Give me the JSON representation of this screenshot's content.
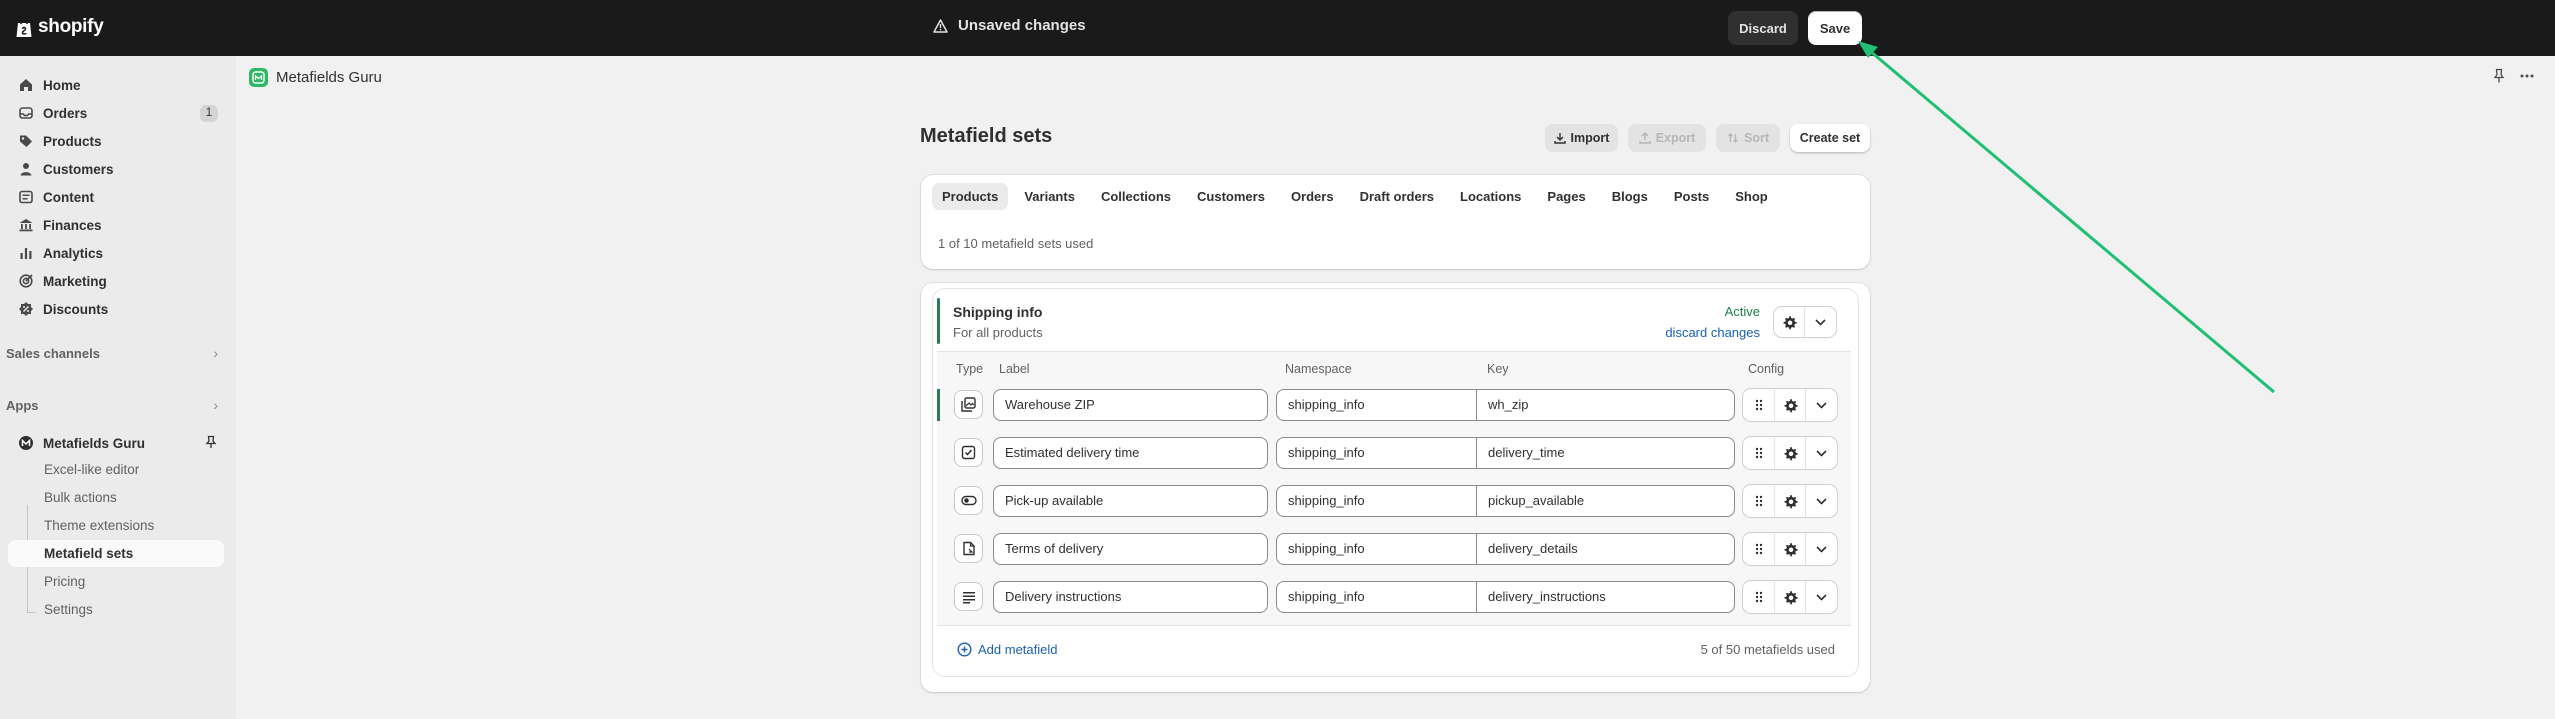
{
  "topbar": {
    "brand": "shopify",
    "unsaved_label": "Unsaved changes",
    "discard_label": "Discard",
    "save_label": "Save"
  },
  "sidebar": {
    "items": [
      {
        "label": "Home",
        "icon": "home-icon"
      },
      {
        "label": "Orders",
        "icon": "inbox-icon",
        "badge": "1"
      },
      {
        "label": "Products",
        "icon": "tag-icon"
      },
      {
        "label": "Customers",
        "icon": "person-icon"
      },
      {
        "label": "Content",
        "icon": "content-icon"
      },
      {
        "label": "Finances",
        "icon": "bank-icon"
      },
      {
        "label": "Analytics",
        "icon": "chart-icon"
      },
      {
        "label": "Marketing",
        "icon": "target-icon"
      },
      {
        "label": "Discounts",
        "icon": "discount-icon"
      }
    ],
    "sales_channels_label": "Sales channels",
    "apps_label": "Apps",
    "app": {
      "name": "Metafields Guru",
      "sub_items": [
        "Excel-like editor",
        "Bulk actions",
        "Theme extensions",
        "Metafield sets",
        "Pricing",
        "Settings"
      ],
      "active_sub_item": "Metafield sets"
    }
  },
  "appbar": {
    "title": "Metafields Guru"
  },
  "page": {
    "title": "Metafield sets",
    "actions": {
      "import": "Import",
      "export": "Export",
      "sort": "Sort",
      "create": "Create set"
    },
    "tabs": [
      "Products",
      "Variants",
      "Collections",
      "Customers",
      "Orders",
      "Draft orders",
      "Locations",
      "Pages",
      "Blogs",
      "Posts",
      "Shop"
    ],
    "active_tab": "Products",
    "sets_used": "1 of 10 metafield sets used"
  },
  "set": {
    "name": "Shipping info",
    "subtitle": "For all products",
    "status": "Active",
    "discard_link": "discard changes",
    "columns": {
      "type": "Type",
      "label": "Label",
      "namespace": "Namespace",
      "key": "Key",
      "config": "Config"
    },
    "rows": [
      {
        "type_icon": "multi-image-icon",
        "label": "Warehouse ZIP",
        "namespace": "shipping_info",
        "key": "wh_zip"
      },
      {
        "type_icon": "checkbox-icon",
        "label": "Estimated delivery time",
        "namespace": "shipping_info",
        "key": "delivery_time"
      },
      {
        "type_icon": "toggle-icon",
        "label": "Pick-up available",
        "namespace": "shipping_info",
        "key": "pickup_available"
      },
      {
        "type_icon": "file-icon",
        "label": "Terms of delivery",
        "namespace": "shipping_info",
        "key": "delivery_details"
      },
      {
        "type_icon": "text-lines-icon",
        "label": "Delivery instructions",
        "namespace": "shipping_info",
        "key": "delivery_instructions"
      }
    ],
    "add_metafield": "Add metafield",
    "metafields_used": "5 of 50 metafields used"
  },
  "colors": {
    "topbar": "#1a1a1a",
    "accent_green": "#2b7a55",
    "link_blue": "#1a5fb4",
    "annotation_arrow": "#1fbf75"
  }
}
